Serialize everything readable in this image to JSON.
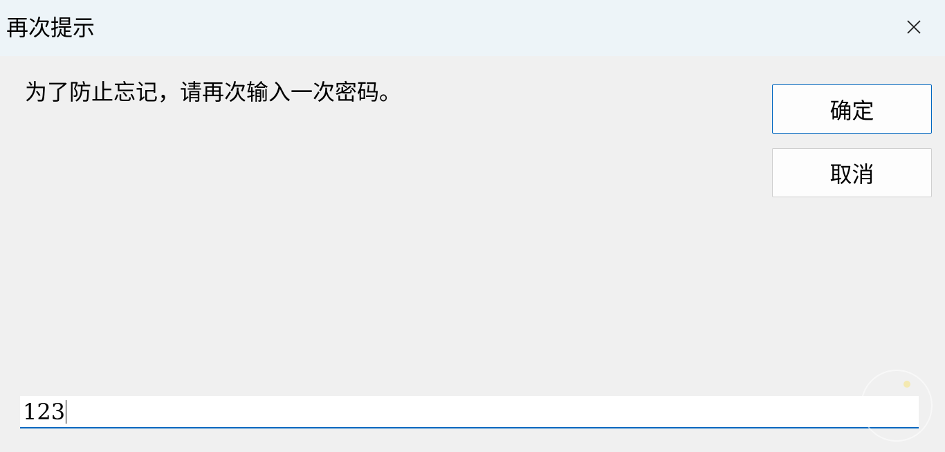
{
  "window": {
    "title": "再次提示",
    "close_icon": "close-icon"
  },
  "dialog": {
    "prompt": "为了防止忘记，请再次输入一次密码。",
    "ok_label": "确定",
    "cancel_label": "取消"
  },
  "input": {
    "value": "123"
  },
  "colors": {
    "accent": "#0067c0",
    "titlebar_bg": "#edf4f8",
    "window_bg": "#f0f0f0"
  }
}
